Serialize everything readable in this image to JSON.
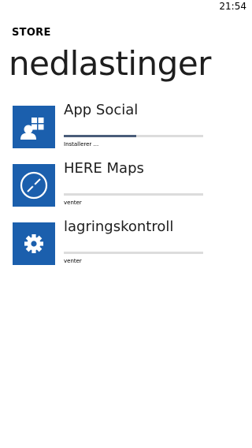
{
  "status_bar": {
    "time": "21:54"
  },
  "app_title": "STORE",
  "page_title": "nedlastinger",
  "colors": {
    "tile": "#1b5fad",
    "progress_fill": "#4a5d7a",
    "progress_track": "#dcdcdc"
  },
  "downloads": [
    {
      "name": "App Social",
      "status": "Installerer ...",
      "icon": "app-social-icon",
      "progress": 0.52
    },
    {
      "name": "HERE Maps",
      "status": "venter",
      "icon": "compass-icon",
      "progress": 0
    },
    {
      "name": "lagringskontroll",
      "status": "venter",
      "icon": "gear-icon",
      "progress": 0
    }
  ]
}
